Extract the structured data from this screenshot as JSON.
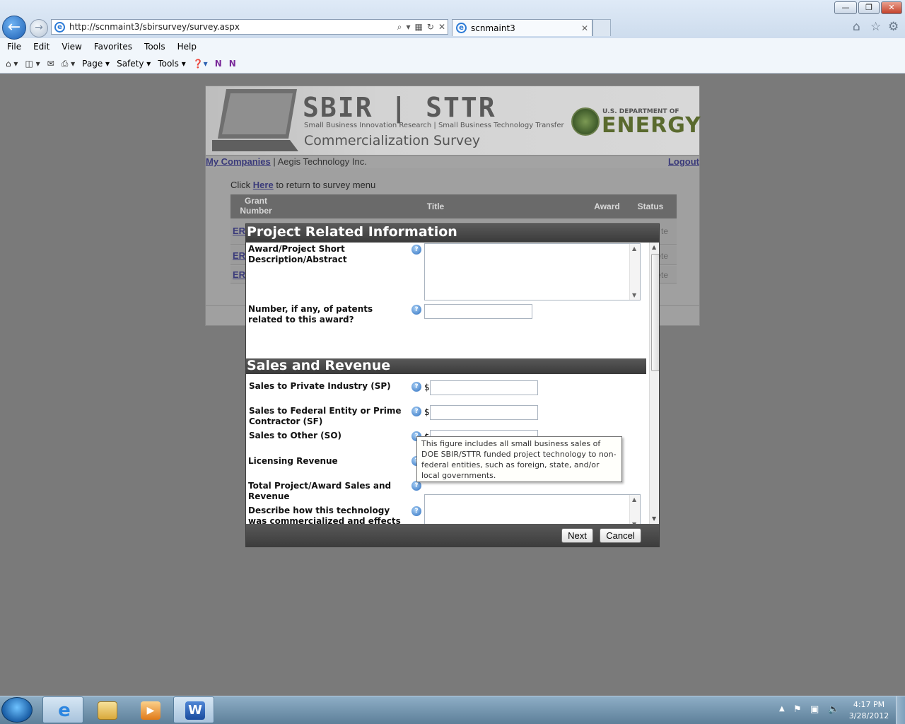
{
  "browser": {
    "url": "http://scnmaint3/sbirsurvey/survey.aspx",
    "tab_title": "scnmaint3",
    "menus": [
      "File",
      "Edit",
      "View",
      "Favorites",
      "Tools",
      "Help"
    ],
    "command_bar": {
      "page": "Page",
      "safety": "Safety",
      "tools": "Tools"
    }
  },
  "banner": {
    "title": "SBIR | STTR",
    "subtitle": "Small Business Innovation Research | Small Business Technology Transfer",
    "survey": "Commercialization Survey",
    "doe_top": "U.S. DEPARTMENT OF",
    "doe_energy": "ENERGY"
  },
  "subnav": {
    "my_companies": "My Companies",
    "separator": " | ",
    "company": "Aegis Technology Inc.",
    "logout": "Logout"
  },
  "page": {
    "click_prefix": "Click ",
    "here_link": "Here",
    "click_suffix": " to return to survey menu",
    "grants_table": {
      "headers": {
        "grant_number": "Grant Number",
        "title": "Title",
        "award": "Award",
        "status": "Status"
      },
      "rows": [
        {
          "grant": "ER",
          "status": "te"
        },
        {
          "grant": "ER",
          "status": "lete"
        },
        {
          "grant": "ER",
          "status": "lete"
        }
      ]
    }
  },
  "modal": {
    "section1_title": "Project Related Information",
    "section2_title": "Sales and Revenue",
    "fields": {
      "abstract": "Award/Project Short Description/Abstract",
      "patents": "Number, if any, of patents related to this award?",
      "sales_private": "Sales to Private Industry (SP)",
      "sales_federal": "Sales to Federal Entity or Prime Contractor (SF)",
      "sales_other": "Sales to Other (SO)",
      "licensing": "Licensing Revenue",
      "total_sales": "Total Project/Award Sales and Revenue",
      "describe": "Describe how this technology was commercialized and effects on SBC"
    },
    "currency_symbol": "$",
    "help_glyph": "?",
    "tooltip": "This figure includes all small business sales of DOE SBIR/STTR funded project technology to non-federal entities, such as foreign, state, and/or local governments.",
    "buttons": {
      "next": "Next",
      "cancel": "Cancel"
    }
  },
  "taskbar": {
    "time": "4:17 PM",
    "date": "3/28/2012"
  }
}
